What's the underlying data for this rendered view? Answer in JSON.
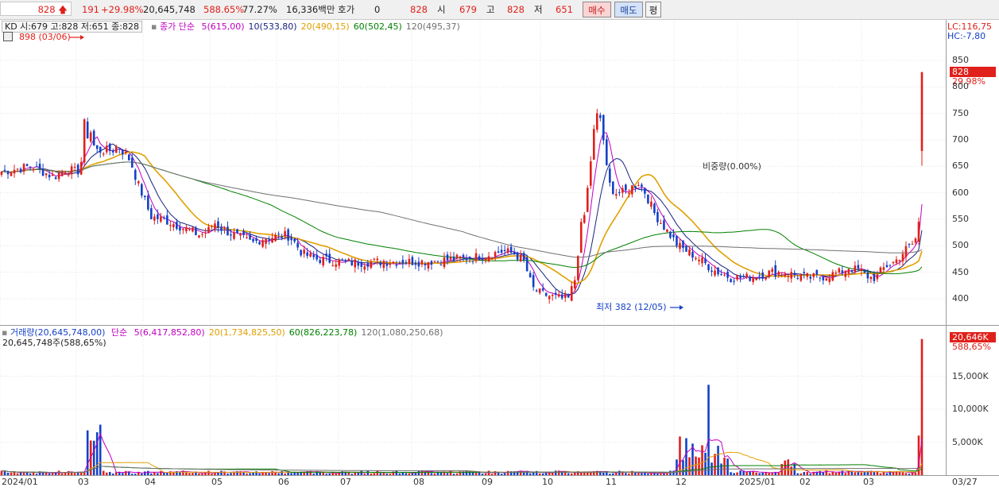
{
  "topbar": {
    "price": "828",
    "change": "191",
    "change_pct": "+29.98%",
    "volume": "20,645,748",
    "vol_ratio": "588.65%",
    "turnover": "77.27%",
    "amount": "16,336백만",
    "quote_label": "호가",
    "quote_value": "0",
    "quote_price": "828",
    "open_label": "시",
    "open": "679",
    "high_label": "고",
    "high": "828",
    "low_label": "저",
    "low": "651",
    "buy": "매수",
    "sell": "매도",
    "eval": "평"
  },
  "price_panel": {
    "stock_box": "KD 시:679 고:828 저:651 종:828",
    "ma_title": "종가 단순",
    "ma": [
      {
        "label": "5(615,00)",
        "color": "#c000c0"
      },
      {
        "label": "10(533,80)",
        "color": "#1a237e"
      },
      {
        "label": "20(490,15)",
        "color": "#e0a000"
      },
      {
        "label": "60(502,45)",
        "color": "#008000"
      },
      {
        "label": "120(495,37)",
        "color": "#707070"
      }
    ],
    "lc": "LC:116,75",
    "hc": "HC:-7,80",
    "high_marker": "898 (03/06)",
    "low_marker": "최저 382 (12/05)",
    "annotation": "비중량(0.00%)",
    "price_tag": "828",
    "pct_tag": "29.98%"
  },
  "volume_panel": {
    "title": "거래량(20,645,748,00)",
    "ma_title": "단순",
    "ma": [
      {
        "label": "5(6,417,852,80)",
        "color": "#c000c0"
      },
      {
        "label": "20(1,734,825,50)",
        "color": "#e0a000"
      },
      {
        "label": "60(826,223,78)",
        "color": "#008000"
      },
      {
        "label": "120(1,080,250,68)",
        "color": "#707070"
      }
    ],
    "sub": "20,645,748주(588,65%)",
    "vol_tag": "20,646K",
    "pct_tag": "588,65%"
  },
  "chart_data": {
    "type": "candlestick",
    "y_ticks": [
      850,
      800,
      750,
      700,
      650,
      600,
      550,
      500,
      450,
      400
    ],
    "vol_ticks": [
      "15,000K",
      "10,000K",
      "5,000K"
    ],
    "x_ticks": [
      "2024/01",
      "03",
      "04",
      "05",
      "06",
      "07",
      "08",
      "09",
      "10",
      "11",
      "12",
      "2025/01",
      "02",
      "03",
      "03/27"
    ],
    "ylim": [
      382,
      898
    ]
  },
  "colors": {
    "up": "#e0201a",
    "down": "#1440c8",
    "ma5": "#c000c0",
    "ma10": "#1a237e",
    "ma20": "#e0a000",
    "ma60": "#008000",
    "ma120": "#707070"
  }
}
